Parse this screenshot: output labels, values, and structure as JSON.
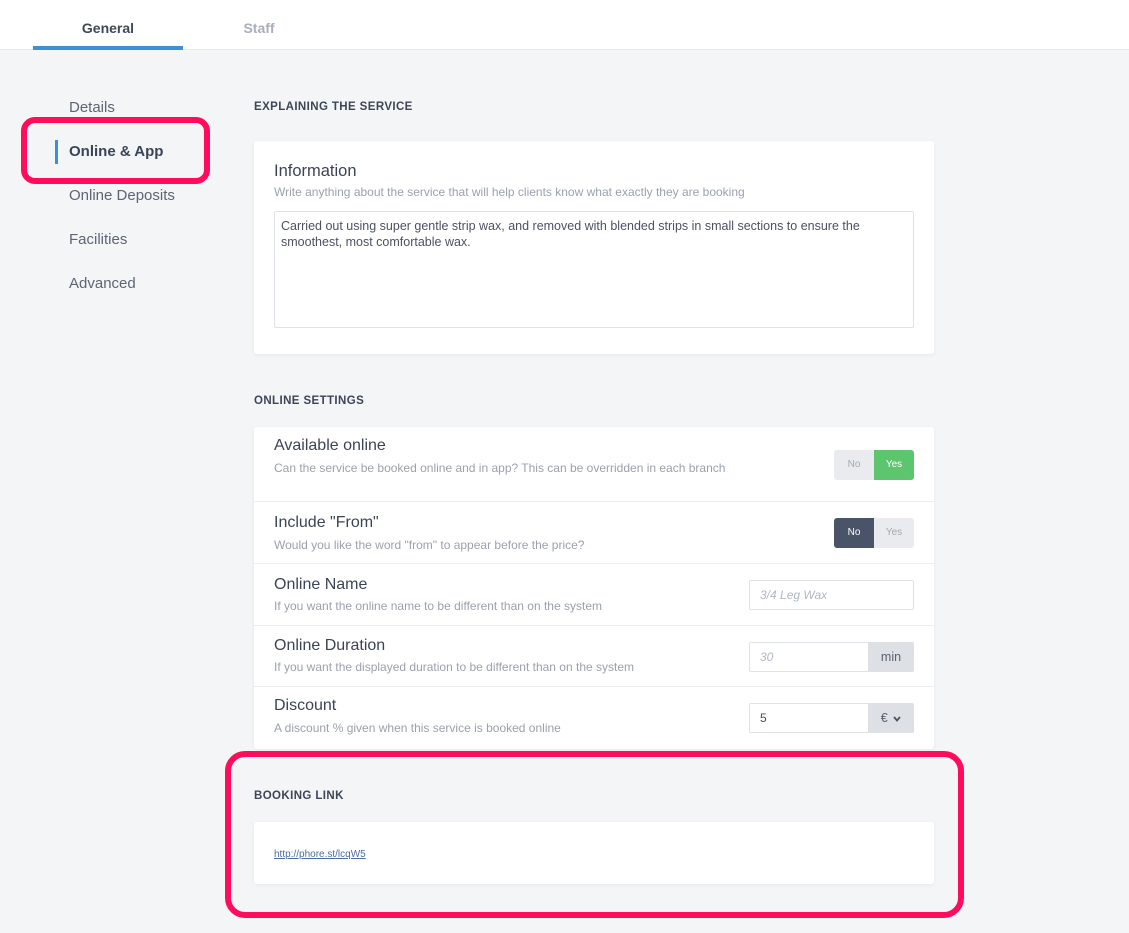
{
  "tabs": {
    "general": "General",
    "staff": "Staff"
  },
  "sidebar": {
    "items": [
      {
        "label": "Details"
      },
      {
        "label": "Online & App"
      },
      {
        "label": "Online Deposits"
      },
      {
        "label": "Facilities"
      },
      {
        "label": "Advanced"
      }
    ],
    "active_index": 1
  },
  "explaining": {
    "section_title": "EXPLAINING THE SERVICE",
    "title": "Information",
    "subtitle": "Write anything about the service that will help clients know what exactly they are booking",
    "text": "Carried out using super gentle strip wax, and removed with blended strips in small sections to ensure the smoothest, most comfortable wax."
  },
  "online_settings": {
    "section_title": "ONLINE SETTINGS",
    "available": {
      "title": "Available online",
      "subtitle": "Can the service be booked online and in app? This can be overridden in each branch",
      "no": "No",
      "yes": "Yes",
      "selected": "Yes"
    },
    "include_from": {
      "title": "Include \"From\"",
      "subtitle": "Would you like the word \"from\" to appear before the price?",
      "no": "No",
      "yes": "Yes",
      "selected": "No"
    },
    "online_name": {
      "title": "Online Name",
      "subtitle": "If you want the online name to be different than on the system",
      "placeholder": "3/4 Leg Wax"
    },
    "online_duration": {
      "title": "Online Duration",
      "subtitle": "If you want the displayed duration to be different than on the system",
      "placeholder": "30",
      "unit": "min"
    },
    "discount": {
      "title": "Discount",
      "subtitle": "A discount % given when this service is booked online",
      "value": "5",
      "currency": "€"
    }
  },
  "booking_link": {
    "section_title": "BOOKING LINK",
    "url": "http://phore.st/lcqW5"
  },
  "colors": {
    "accent": "#3d8fd6",
    "highlight": "#ff0d5c",
    "toggle_on": "#5cc56e",
    "toggle_dark": "#4a5468"
  }
}
